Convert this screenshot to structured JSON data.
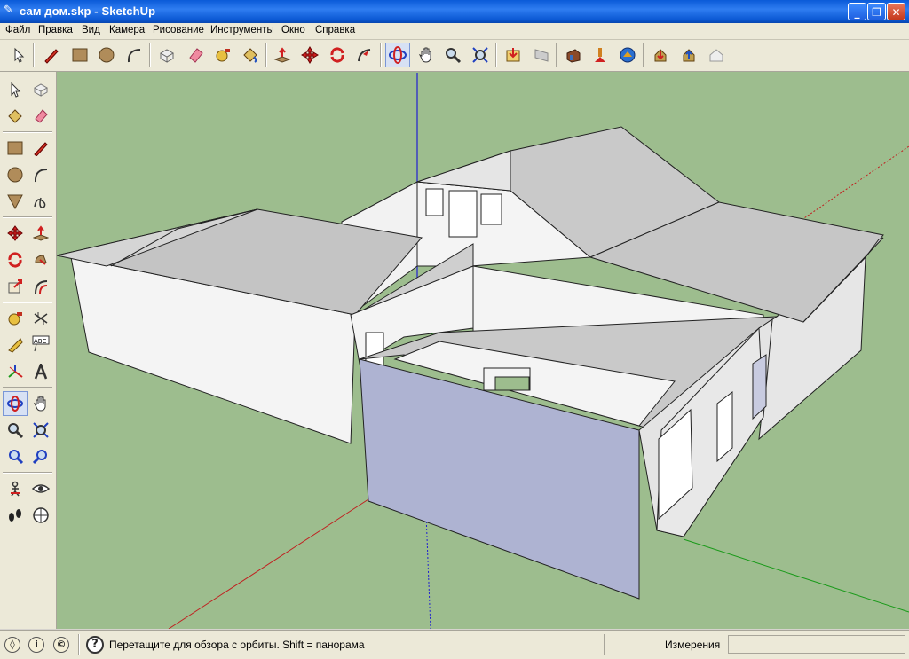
{
  "window": {
    "title": "сам дом.skp - SketchUp",
    "minimize_label": "_",
    "maximize_label": "❐",
    "close_label": "✕"
  },
  "menu": {
    "items": [
      "Файл",
      "Правка",
      "Вид",
      "Камера",
      "Рисование",
      "Инструменты",
      "Окно",
      "Справка"
    ]
  },
  "toolbar": {
    "icons": [
      "select-icon",
      "pencil-icon",
      "rectangle-icon",
      "circle-icon",
      "arc-icon",
      "make-component-icon",
      "eraser-icon",
      "tape-measure-icon",
      "paint-bucket-icon",
      "push-pull-icon",
      "move-icon",
      "rotate-icon",
      "follow-me-icon",
      "orbit-icon",
      "pan-icon",
      "zoom-icon",
      "zoom-extents-icon",
      "get-models-icon",
      "share-model-icon",
      "components-3d-icon",
      "place-model-icon",
      "get-current-view-icon",
      "toggle-terrain-icon",
      "import-icon",
      "export-icon",
      "share-component-icon"
    ],
    "pressed": "orbit-icon"
  },
  "left_toolbar": {
    "icons": [
      "select-icon",
      "make-component-icon",
      "paint-bucket-icon",
      "eraser-icon",
      "rectangle-icon",
      "line-icon",
      "circle-icon",
      "arc-icon",
      "polygon-icon",
      "freehand-icon",
      "move-icon",
      "push-pull-icon",
      "rotate-icon",
      "follow-me-icon",
      "scale-icon",
      "offset-icon",
      "tape-measure-icon",
      "dimension-icon",
      "protractor-icon",
      "text-icon",
      "axes-icon",
      "3d-text-icon",
      "orbit-icon",
      "pan-icon",
      "zoom-icon",
      "zoom-window-icon",
      "previous-view-icon",
      "zoom-extents-icon",
      "position-camera-icon",
      "look-around-icon",
      "walk-icon",
      "section-plane-icon"
    ],
    "text_abc": "ABC",
    "pressed": "orbit-icon"
  },
  "status": {
    "hint": "Перетащите для обзора с орбиты.  Shift = панорама",
    "help_icon_glyph": "?",
    "measurements_label": "Измерения",
    "measurements_value": ""
  },
  "colors": {
    "sky_ground": "#9dbd8e",
    "face_white": "#f4f4f4",
    "face_blue": "#aeb3d2",
    "roof_gray": "#c9c9c9",
    "axis_red": "#c02020",
    "axis_green": "#1a9a1a",
    "axis_blue": "#2020d0"
  }
}
